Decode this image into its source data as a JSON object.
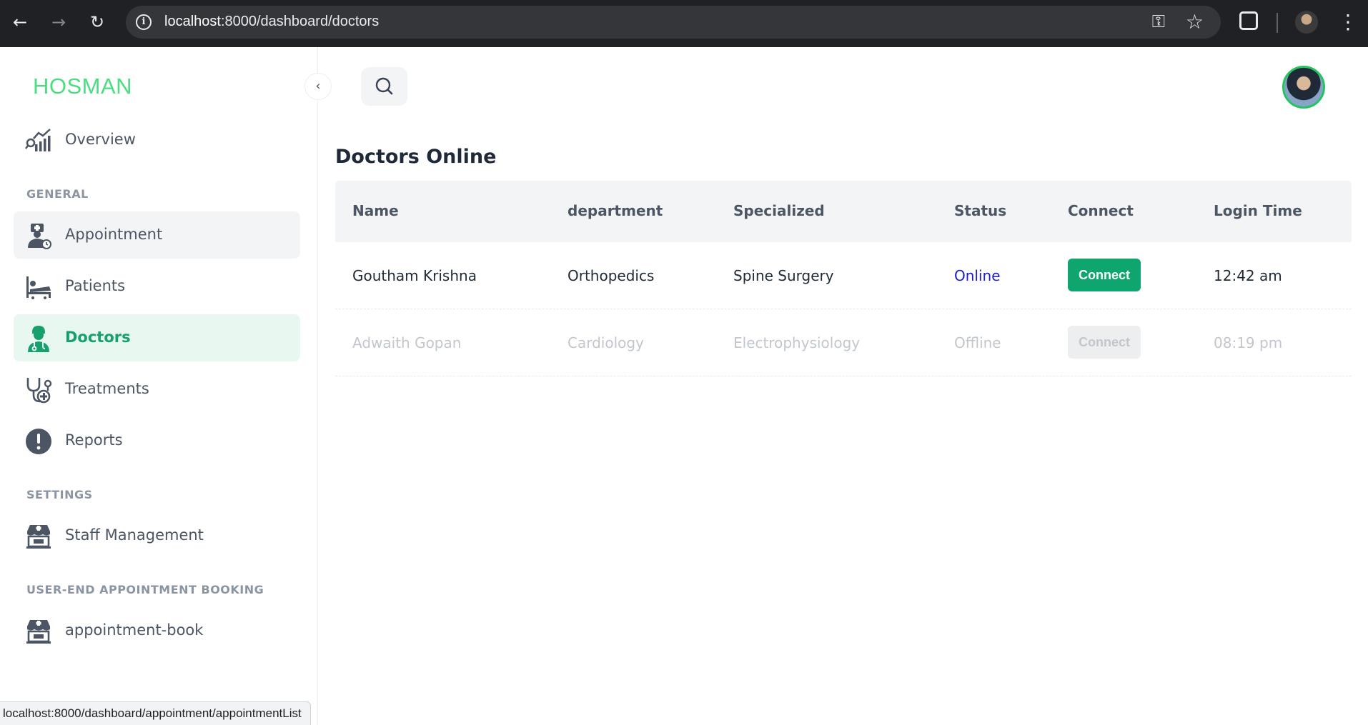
{
  "browser": {
    "url_host": "localhost",
    "url_rest": ":8000/dashboard/doctors",
    "status_url": "localhost:8000/dashboard/appointment/appointmentList"
  },
  "sidebar": {
    "brand": "HOSMAN",
    "overview": "Overview",
    "sections": {
      "general": "GENERAL",
      "settings": "SETTINGS",
      "user_end": "USER-END APPOINTMENT BOOKING"
    },
    "items": {
      "appointment": "Appointment",
      "patients": "Patients",
      "doctors": "Doctors",
      "treatments": "Treatments",
      "reports": "Reports",
      "staff": "Staff Management",
      "appointment_book": "appointment-book"
    }
  },
  "main": {
    "title": "Doctors Online",
    "columns": {
      "name": "Name",
      "department": "department",
      "specialized": "Specialized",
      "status": "Status",
      "connect": "Connect",
      "login_time": "Login Time"
    },
    "rows": [
      {
        "name": "Goutham Krishna",
        "department": "Orthopedics",
        "specialized": "Spine Surgery",
        "status": "Online",
        "connect": "Connect",
        "login_time": "12:42 am"
      },
      {
        "name": "Adwaith Gopan",
        "department": "Cardiology",
        "specialized": "Electrophysiology",
        "status": "Offline",
        "connect": "Connect",
        "login_time": "08:19 pm"
      }
    ]
  },
  "colors": {
    "brand": "#4ade80",
    "active": "#16a06b",
    "connect": "#0ea66e",
    "online": "#1d1dcf"
  }
}
